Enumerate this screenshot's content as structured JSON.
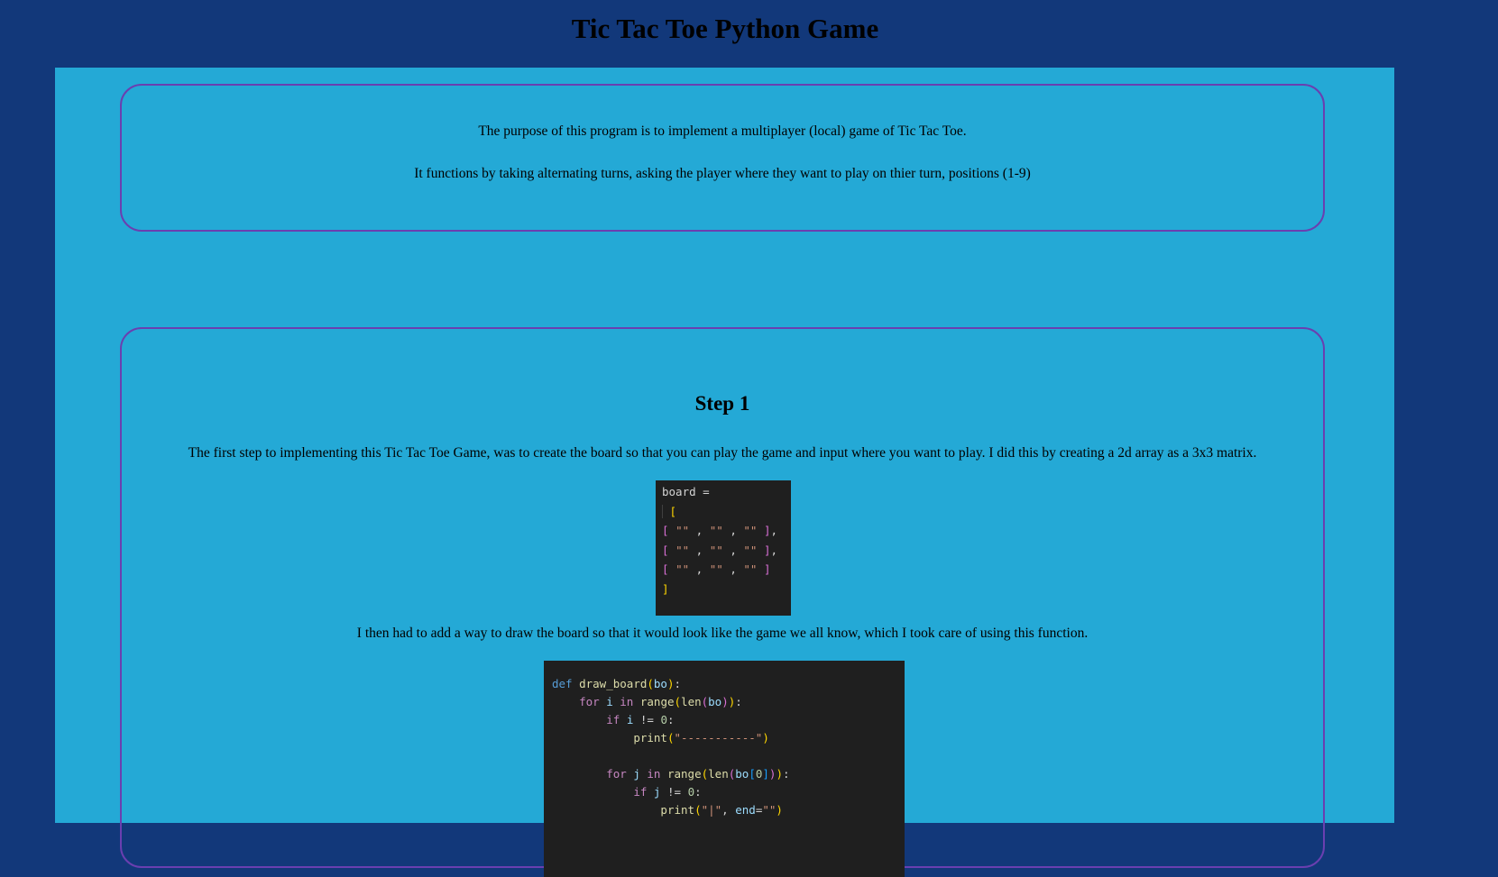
{
  "header": {
    "title": "Tic Tac Toe Python Game"
  },
  "intro": {
    "line1": "The purpose of this program is to implement a multiplayer (local) game of Tic Tac Toe.",
    "line2": "It functions by taking alternating turns, asking the player where they want to play on thier turn, positions (1-9)"
  },
  "step1": {
    "title": "Step 1",
    "text1": "The first step to implementing this Tic Tac Toe Game, was to create the board so that you can play the game and input where you want to play. I did this by creating a 2d array as a 3x3 matrix.",
    "text2": "I then had to add a way to draw the board so that it would look like the game we all know, which I took care of using this function.",
    "board_code": {
      "var": "board",
      "op": "=",
      "open": "[",
      "row_open": "[",
      "cell": "\"\"",
      "sep": ",",
      "row_close": "]",
      "close": "]"
    },
    "draw_code": {
      "def": "def",
      "fn": "draw_board",
      "param": "bo",
      "for": "for",
      "in": "in",
      "if": "if",
      "i": "i",
      "j": "j",
      "range": "range",
      "len": "len",
      "print": "print",
      "neq": "!=",
      "zero": "0",
      "dashes": "\"-----------\"",
      "pipe": "\"|\"",
      "end_kw": "end",
      "empty": "\"\""
    }
  },
  "colors": {
    "background": "#12387a",
    "content": "#24a9d6",
    "card_border": "#6a3fb0",
    "code_bg": "#1f1f1f"
  }
}
